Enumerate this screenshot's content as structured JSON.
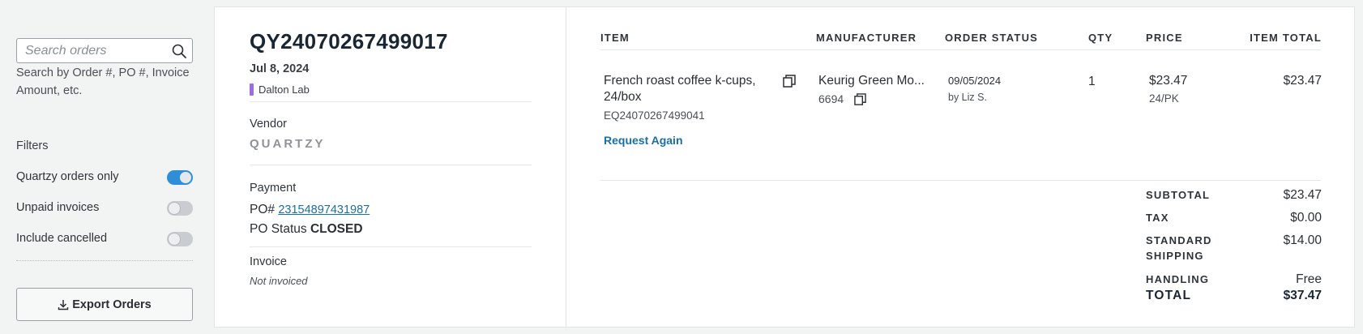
{
  "sidebar": {
    "search_placeholder": "Search orders",
    "search_help": "Search by Order #, PO #, Invoice Amount, etc.",
    "filters_heading": "Filters",
    "filters": [
      {
        "label": "Quartzy orders only",
        "enabled": true
      },
      {
        "label": "Unpaid invoices",
        "enabled": false
      },
      {
        "label": "Include cancelled",
        "enabled": false
      }
    ],
    "export_label": "Export Orders"
  },
  "order": {
    "number": "QY24070267499017",
    "date": "Jul 8, 2024",
    "lab": "Dalton Lab",
    "lab_color": "#9b6ee0",
    "vendor_label": "Vendor",
    "vendor_name": "QUARTZY",
    "payment_label": "Payment",
    "po_prefix": "PO#",
    "po_number": "23154897431987",
    "po_status_label": "PO Status",
    "po_status": "CLOSED",
    "invoice_label": "Invoice",
    "invoice_status": "Not invoiced"
  },
  "items_table": {
    "headers": {
      "item": "ITEM",
      "manufacturer": "MANUFACTURER",
      "order_status": "ORDER STATUS",
      "qty": "QTY",
      "price": "PRICE",
      "item_total": "ITEM TOTAL"
    },
    "rows": [
      {
        "name": "French roast coffee k-cups, 24/box",
        "sku": "EQ24070267499041",
        "request_again": "Request Again",
        "manufacturer": "Keurig Green Mo...",
        "manufacturer_code": "6694",
        "status_date": "09/05/2024",
        "status_by": "by Liz S.",
        "qty": "1",
        "price": "$23.47",
        "unit": "24/PK",
        "total": "$23.47"
      }
    ]
  },
  "summary": {
    "subtotal_label": "SUBTOTAL",
    "subtotal": "$23.47",
    "tax_label": "TAX",
    "tax": "$0.00",
    "shipping_label": "STANDARD SHIPPING",
    "shipping": "$14.00",
    "handling_label": "HANDLING",
    "handling": "Free",
    "total_label": "TOTAL",
    "total": "$37.47"
  },
  "colors": {
    "link": "#1b6fa3",
    "toggle_on": "#2e8fd8",
    "lab_marker": "#9b6ee0"
  },
  "icons": [
    "search-icon",
    "copy-icon",
    "download-icon"
  ]
}
